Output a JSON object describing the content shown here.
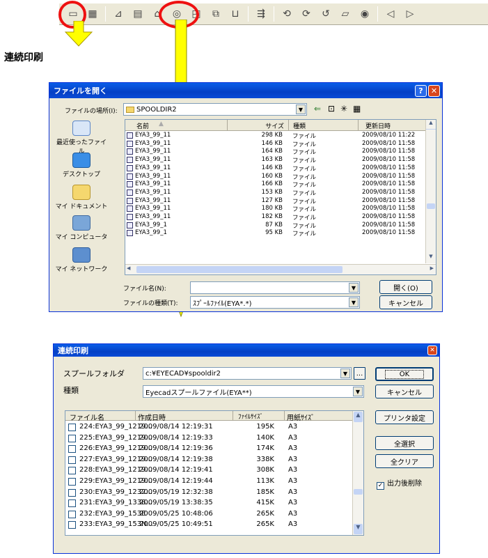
{
  "heading": "連続印刷",
  "toolbar": {
    "icons": [
      "open-folder-icon",
      "table-icon",
      "chart-icon",
      "form-icon",
      "flag-icon",
      "sigma-icon",
      "print-preview-icon",
      "find-icon",
      "sort-icon",
      "layout-icon",
      "run-icon",
      "zoom-out-icon",
      "zoom-in-icon",
      "zoom-fit-icon",
      "note-icon",
      "eye-icon",
      "prev-icon",
      "next-icon"
    ]
  },
  "open_dialog": {
    "title": "ファイルを開く",
    "location_label": "ファイルの場所(I):",
    "location_value": "SPOOLDIR2",
    "places": [
      "最近使ったファイル",
      "デスクトップ",
      "マイ ドキュメント",
      "マイ コンピュータ",
      "マイ ネットワーク"
    ],
    "columns": [
      "名前",
      "サイズ",
      "種類",
      "更新日時"
    ],
    "rows": [
      {
        "name": "EYA3_99_11",
        "size": "298 KB",
        "type": "ファイル",
        "date": "2009/08/10 11:22"
      },
      {
        "name": "EYA3_99_11",
        "size": "146 KB",
        "type": "ファイル",
        "date": "2009/08/10 11:58"
      },
      {
        "name": "EYA3_99_11",
        "size": "164 KB",
        "type": "ファイル",
        "date": "2009/08/10 11:58"
      },
      {
        "name": "EYA3_99_11",
        "size": "163 KB",
        "type": "ファイル",
        "date": "2009/08/10 11:58"
      },
      {
        "name": "EYA3_99_11",
        "size": "146 KB",
        "type": "ファイル",
        "date": "2009/08/10 11:58"
      },
      {
        "name": "EYA3_99_11",
        "size": "160 KB",
        "type": "ファイル",
        "date": "2009/08/10 11:58"
      },
      {
        "name": "EYA3_99_11",
        "size": "166 KB",
        "type": "ファイル",
        "date": "2009/08/10 11:58"
      },
      {
        "name": "EYA3_99_11",
        "size": "153 KB",
        "type": "ファイル",
        "date": "2009/08/10 11:58"
      },
      {
        "name": "EYA3_99_11",
        "size": "127 KB",
        "type": "ファイル",
        "date": "2009/08/10 11:58"
      },
      {
        "name": "EYA3_99_11",
        "size": "180 KB",
        "type": "ファイル",
        "date": "2009/08/10 11:58"
      },
      {
        "name": "EYA3_99_11",
        "size": "182 KB",
        "type": "ファイル",
        "date": "2009/08/10 11:58"
      },
      {
        "name": "EYA3_99_1",
        "size": "87 KB",
        "type": "ファイル",
        "date": "2009/08/10 11:58"
      },
      {
        "name": "EYA3_99_1",
        "size": "95 KB",
        "type": "ファイル",
        "date": "2009/08/10 11:58"
      }
    ],
    "filename_label": "ファイル名(N):",
    "filename_value": "",
    "filetype_label": "ファイルの種類(T):",
    "filetype_value": "ｽﾌﾟｰﾙﾌｧｲﾙ(EYA*.*)",
    "open_button": "開く(O)",
    "cancel_button": "キャンセル",
    "help_button": "?",
    "close_button": "✕"
  },
  "print_dialog": {
    "title": "連続印刷",
    "spool_label": "スプールフォルダ",
    "spool_value": "c:¥EYECAD¥spooldir2",
    "browse_button": "...",
    "type_label": "種類",
    "type_value": "Eyecadスプールファイル(EYA**)",
    "columns": [
      "ファイル名",
      "作成日時",
      "ﾌｧｲﾙｻｲｽﾞ",
      "用紙ｻｲｽﾞ"
    ],
    "rows": [
      {
        "name": "224:EYA3_99_1219...",
        "date": "2009/08/14 12:19:31",
        "size": "195K",
        "paper": "A3"
      },
      {
        "name": "225:EYA3_99_1219...",
        "date": "2009/08/14 12:19:33",
        "size": "140K",
        "paper": "A3"
      },
      {
        "name": "226:EYA3_99_1219...",
        "date": "2009/08/14 12:19:36",
        "size": "174K",
        "paper": "A3"
      },
      {
        "name": "227:EYA3_99_1219...",
        "date": "2009/08/14 12:19:38",
        "size": "338K",
        "paper": "A3"
      },
      {
        "name": "228:EYA3_99_1219...",
        "date": "2009/08/14 12:19:41",
        "size": "308K",
        "paper": "A3"
      },
      {
        "name": "229:EYA3_99_1219...",
        "date": "2009/08/14 12:19:44",
        "size": "113K",
        "paper": "A3"
      },
      {
        "name": "230:EYA3_99_1232...",
        "date": "2009/05/19 12:32:38",
        "size": "185K",
        "paper": "A3"
      },
      {
        "name": "231:EYA3_99_1338...",
        "date": "2009/05/19 13:38:35",
        "size": "415K",
        "paper": "A3"
      },
      {
        "name": "232:EYA3_99_153E",
        "date": "2009/05/25 10:48:06",
        "size": "265K",
        "paper": "A3"
      },
      {
        "name": "233:EYA3_99_153N...",
        "date": "2009/05/25 10:49:51",
        "size": "265K",
        "paper": "A3"
      }
    ],
    "ok_button": "OK",
    "cancel_button": "キャンセル",
    "printer_button": "プリンタ設定",
    "select_all_button": "全選択",
    "clear_all_button": "全クリア",
    "delete_after_label": "出力後削除",
    "delete_after_checked": true,
    "close_button": "✕"
  },
  "colors": {
    "highlight_circle": "#e11111",
    "arrow_fill": "#ffff00",
    "titlebar": "#0a5ee8"
  }
}
